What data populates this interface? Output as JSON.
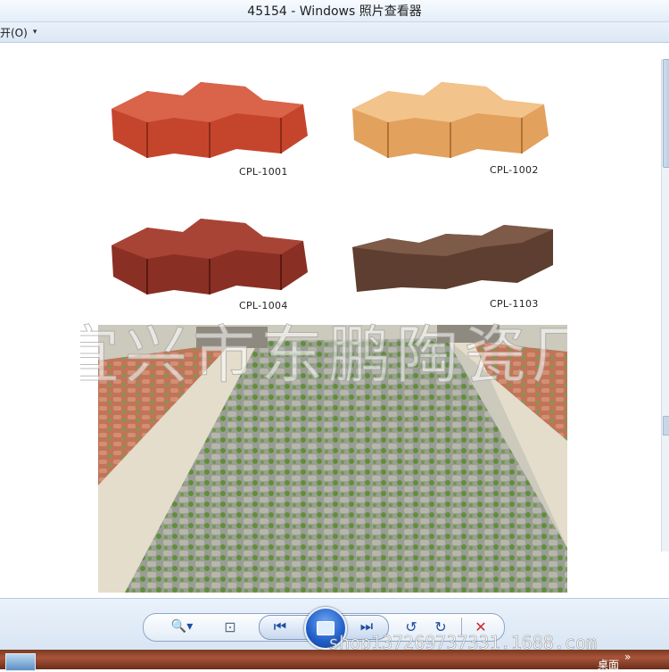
{
  "window": {
    "title": "45154 - Windows 照片查看器"
  },
  "menubar": {
    "open_label": "开(O)",
    "caret": "▾"
  },
  "photo": {
    "products": [
      {
        "code": "CPL-1001",
        "color": "#c5452c"
      },
      {
        "code": "CPL-1002",
        "color": "#e9a863"
      },
      {
        "code": "CPL-1004",
        "color": "#8a2f24"
      },
      {
        "code": "CPL-1103",
        "color": "#6b4a3a"
      }
    ],
    "watermark": "宜兴市东鹏陶瓷厂"
  },
  "controls": {
    "zoom_icon": "🔍▾",
    "fit_icon": "⊡",
    "prev_icon": "⏮",
    "next_icon": "⏭",
    "rotate_ccw_icon": "↺",
    "rotate_cw_icon": "↻",
    "delete_icon": "✕"
  },
  "overlay_url": "shop137269737331.1688.com",
  "taskbar": {
    "desktop_label": "桌面",
    "chevron": "»"
  }
}
